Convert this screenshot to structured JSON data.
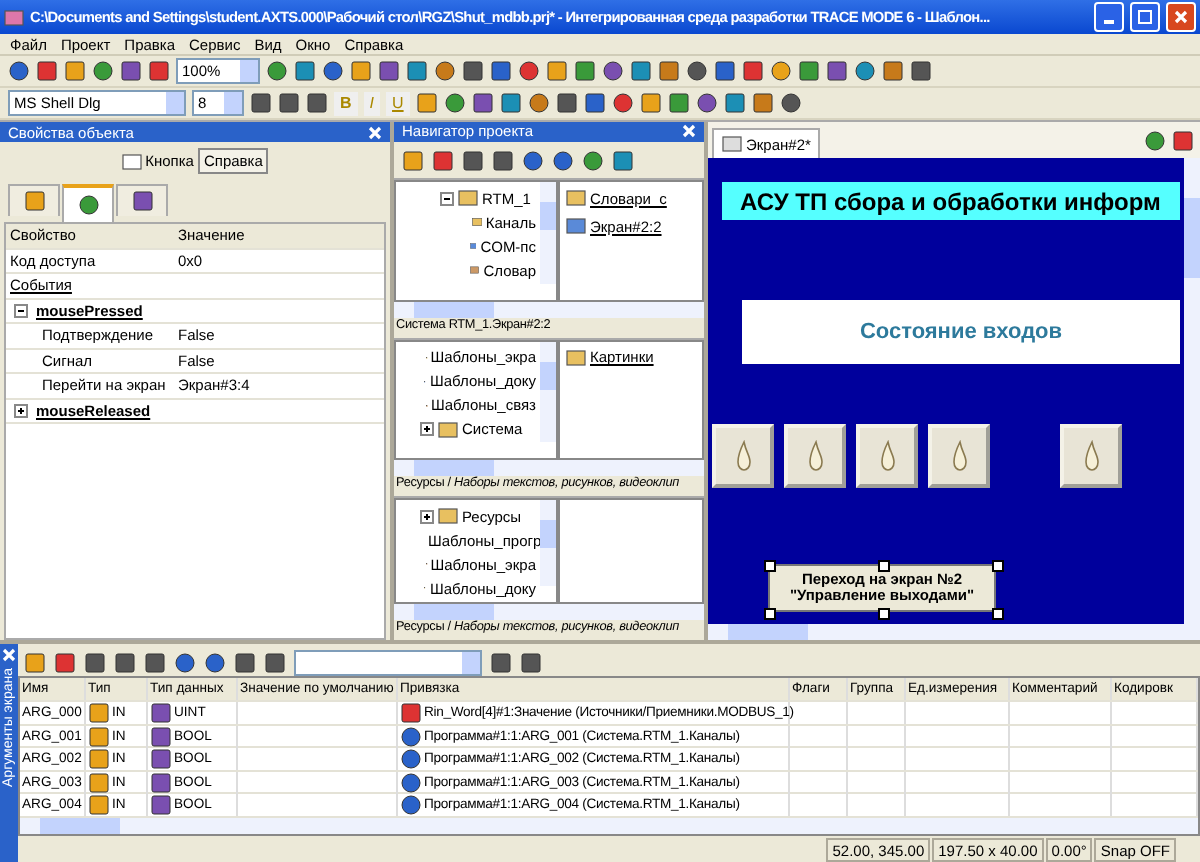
{
  "window": {
    "title": "C:\\Documents and Settings\\student.AXTS.000\\Рабочий стол\\RGZ\\Shut_mdbb.prj* - Интегрированная среда разработки TRACE MODE 6 - Шаблон..."
  },
  "menu": [
    "Файл",
    "Проект",
    "Правка",
    "Сервис",
    "Вид",
    "Окно",
    "Справка"
  ],
  "toolbar": {
    "zoom": "100%",
    "font": "MS Shell Dlg",
    "font_size": "8",
    "style_buttons": [
      "B",
      "I",
      "U"
    ]
  },
  "properties_panel": {
    "title": "Свойства объекта",
    "object_type": "Кнопка",
    "help_button": "Справка",
    "tabs": [
      {
        "selected": false
      },
      {
        "selected": true
      },
      {
        "selected": false
      }
    ],
    "columns": [
      "Свойство",
      "Значение"
    ],
    "rows": [
      {
        "kind": "plain",
        "name": "Код доступа",
        "value": "0x0"
      },
      {
        "kind": "group",
        "name": "События"
      },
      {
        "kind": "event",
        "name": "mousePressed",
        "expanded": true,
        "children": [
          {
            "name": "Подтверждение",
            "value": "False"
          },
          {
            "name": "Сигнал",
            "value": "False"
          },
          {
            "name": "Перейти на экран",
            "value": "Экран#3:4"
          }
        ]
      },
      {
        "kind": "event",
        "name": "mouseReleased",
        "expanded": false
      }
    ]
  },
  "navigator": {
    "title": "Навигатор проекта",
    "sections": [
      {
        "tree": [
          {
            "label": "RTM_1",
            "expanded": true,
            "children": [
              {
                "label": "Каналь"
              },
              {
                "label": "COM-пс"
              },
              {
                "label": "Словар"
              }
            ]
          }
        ],
        "items": [
          "Словари_с",
          "Экран#2:2"
        ],
        "caption": "Система RTM_1.Экран#2:2"
      },
      {
        "tree": [
          {
            "label": "Шаблоны_экра"
          },
          {
            "label": "Шаблоны_доку"
          },
          {
            "label": "Шаблоны_связ"
          },
          {
            "label": "Система",
            "expanded": false
          }
        ],
        "items": [
          "Картинки"
        ],
        "caption": "Ресурсы / *Наборы текстов, рисунков, видеоклип*"
      },
      {
        "tree": [
          {
            "label": "Ресурсы",
            "expanded": false
          },
          {
            "label": "Шаблоны_прогр"
          },
          {
            "label": "Шаблоны_экра"
          },
          {
            "label": "Шаблоны_доку"
          }
        ],
        "caption": "Ресурсы / *Наборы текстов, рисунков, видеоклип*"
      }
    ]
  },
  "editor": {
    "tab": "Экран#2*",
    "title_label": "АСУ ТП сбора и обработки информ",
    "subtitle": "Состояние входов",
    "button": {
      "lines": [
        "Переход на экран №2",
        "\"Управление выходами\""
      ],
      "selected": true
    }
  },
  "arguments_panel": {
    "side_tab": "Аргументы экрана",
    "columns": [
      "Имя",
      "Тип",
      "Тип данных",
      "Значение по умолчанию",
      "Привязка",
      "Флаги",
      "Группа",
      "Ед.измерения",
      "Комментарий",
      "Кодировк"
    ],
    "rows": [
      {
        "name": "ARG_000",
        "type": "IN",
        "data_type": "UINT",
        "kind": "channel",
        "binding": "Rin_Word[4]#1:Значение (Источники/Приемники.MODBUS_1)"
      },
      {
        "name": "ARG_001",
        "type": "IN",
        "data_type": "BOOL",
        "kind": "program",
        "binding": "Программа#1:1:ARG_001 (Система.RTM_1.Каналы)"
      },
      {
        "name": "ARG_002",
        "type": "IN",
        "data_type": "BOOL",
        "kind": "program",
        "binding": "Программа#1:1:ARG_002 (Система.RTM_1.Каналы)"
      },
      {
        "name": "ARG_003",
        "type": "IN",
        "data_type": "BOOL",
        "kind": "program",
        "binding": "Программа#1:1:ARG_003 (Система.RTM_1.Каналы)"
      },
      {
        "name": "ARG_004",
        "type": "IN",
        "data_type": "BOOL",
        "kind": "program",
        "binding": "Программа#1:1:ARG_004 (Система.RTM_1.Каналы)"
      }
    ]
  },
  "status_bar": [
    "52.00, 345.00",
    "197.50 x 40.00",
    "0.00°",
    "Snap OFF"
  ]
}
